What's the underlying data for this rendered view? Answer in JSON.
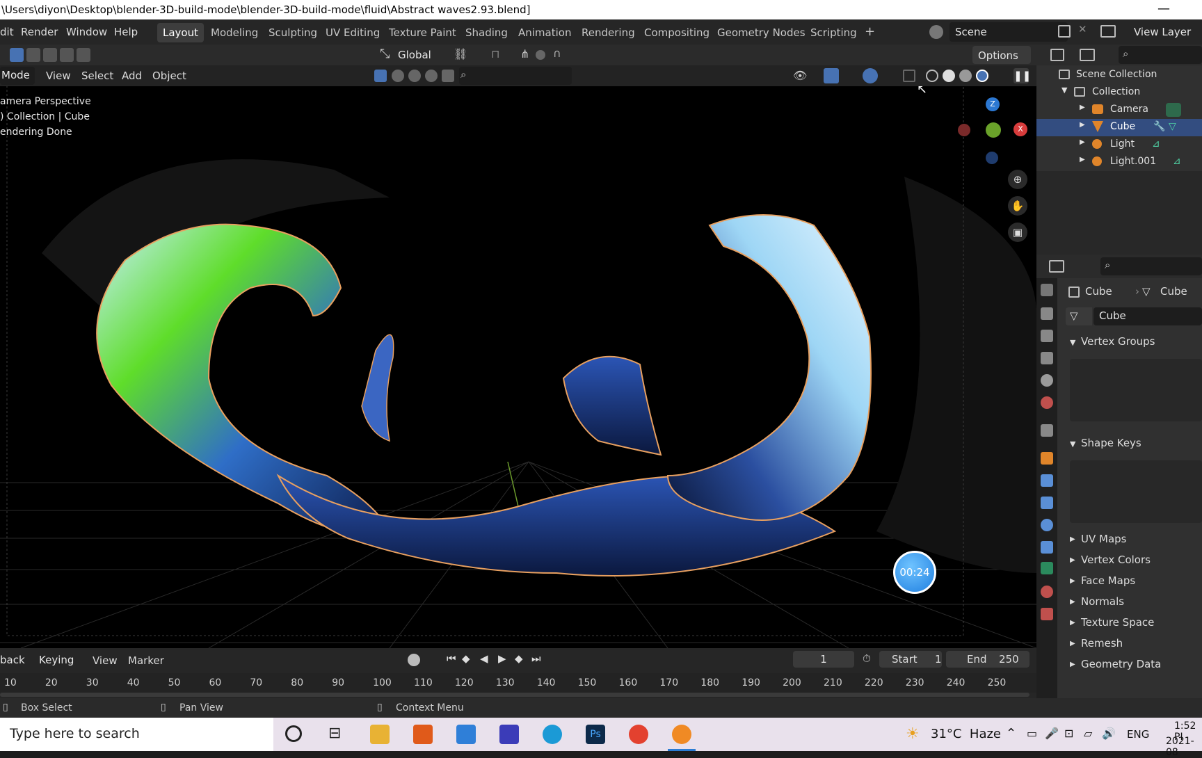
{
  "window": {
    "title": "\\Users\\diyon\\Desktop\\blender-3D-build-mode\\blender-3D-build-mode\\fluid\\Abstract waves2.93.blend]"
  },
  "menus": [
    "dit",
    "Render",
    "Window",
    "Help"
  ],
  "workspaces": [
    "Layout",
    "Modeling",
    "Sculpting",
    "UV Editing",
    "Texture Paint",
    "Shading",
    "Animation",
    "Rendering",
    "Compositing",
    "Geometry Nodes",
    "Scripting"
  ],
  "scene": {
    "name": "Scene",
    "view_layer": "View Layer"
  },
  "toolbar": {
    "orientation": "Global",
    "options": "Options"
  },
  "viewport_header": {
    "mode": "Mode",
    "items": [
      "View",
      "Select",
      "Add",
      "Object"
    ]
  },
  "viewport": {
    "overlay_lines": [
      "amera Perspective",
      ") Collection | Cube",
      "endering Done"
    ],
    "timer": "00:24",
    "gizmo": {
      "z": "Z",
      "x": "X"
    }
  },
  "outliner": {
    "root": "Scene Collection",
    "collection": "Collection",
    "items": [
      "Camera",
      "Cube",
      "Light",
      "Light.001"
    ],
    "selected": "Cube"
  },
  "properties": {
    "breadcrumb": [
      "Cube",
      "Cube"
    ],
    "mesh_name": "Cube",
    "sections_open": [
      "Vertex Groups",
      "Shape Keys"
    ],
    "sections_closed": [
      "UV Maps",
      "Vertex Colors",
      "Face Maps",
      "Normals",
      "Texture Space",
      "Remesh",
      "Geometry Data"
    ]
  },
  "timeline": {
    "playback": "back",
    "keying": "Keying",
    "view": "View",
    "marker": "Marker",
    "current_frame": "1",
    "start_label": "Start",
    "start": "1",
    "end_label": "End",
    "end": "250",
    "ruler": [
      "10",
      "20",
      "30",
      "40",
      "50",
      "60",
      "70",
      "80",
      "90",
      "100",
      "110",
      "120",
      "130",
      "140",
      "150",
      "160",
      "170",
      "180",
      "190",
      "200",
      "210",
      "220",
      "230",
      "240",
      "250"
    ]
  },
  "statusbar": {
    "left": "Box Select",
    "middle": "Pan View",
    "right": "Context Menu"
  },
  "taskbar": {
    "search_placeholder": "Type here to search",
    "weather": "31°C  Haze",
    "lang": "ENG",
    "time": "1:52 PI",
    "date": "2021-08"
  },
  "colors": {
    "selection": "#334d80",
    "accent": "#4772b3",
    "timer": "#2b8cf0"
  }
}
